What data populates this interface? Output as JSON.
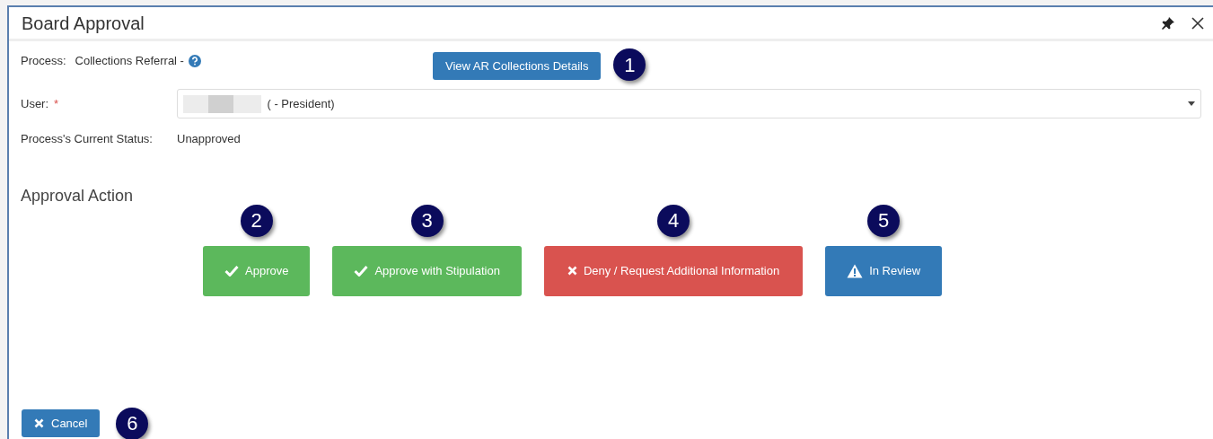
{
  "window": {
    "title": "Board Approval"
  },
  "process": {
    "label": "Process:",
    "value": "Collections Referral -",
    "button": "View AR Collections Details",
    "callout": "1"
  },
  "user": {
    "label": "User:",
    "required_mark": "*",
    "value": "( - President)"
  },
  "status": {
    "label": "Process's Current Status:",
    "value": "Unapproved"
  },
  "approval": {
    "heading": "Approval Action",
    "actions": [
      {
        "kind": "approve",
        "label": "Approve",
        "callout": "2"
      },
      {
        "kind": "approve",
        "label": "Approve with Stipulation",
        "callout": "3"
      },
      {
        "kind": "deny",
        "label": "Deny / Request Additional Information",
        "callout": "4"
      },
      {
        "kind": "review",
        "label": "In Review",
        "callout": "5"
      }
    ]
  },
  "cancel": {
    "label": "Cancel",
    "callout": "6"
  }
}
